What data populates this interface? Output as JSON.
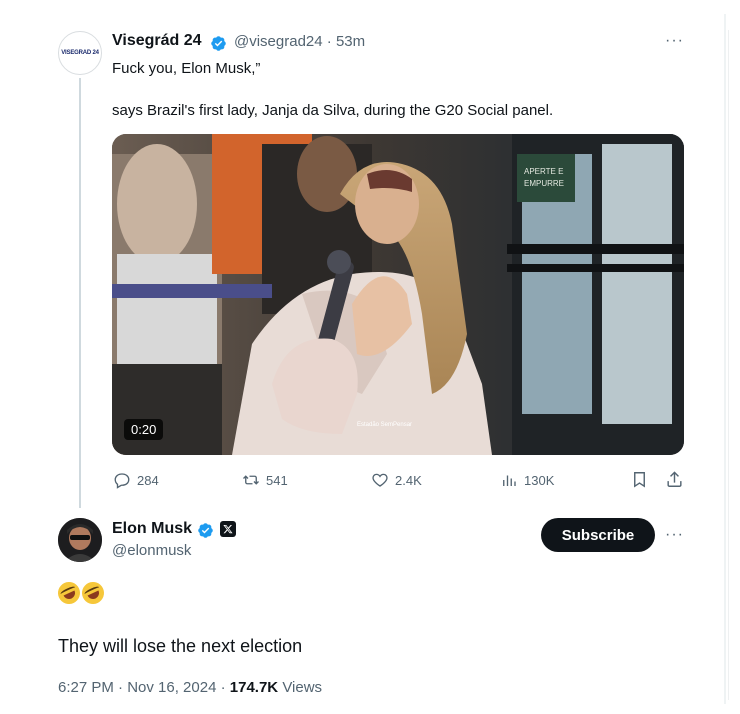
{
  "original_tweet": {
    "author_name": "Visegrád 24",
    "handle": "@visegrad24",
    "separator": "·",
    "time_ago": "53m",
    "avatar_text": "VISEGRAD 24",
    "line1": "Fuck you, Elon Musk,”",
    "line2": "says Brazil's first lady, Janja da Silva, during the G20 Social panel.",
    "video": {
      "duration": "0:20",
      "watermark": "Estadão SemPensar"
    },
    "actions": {
      "replies": "284",
      "reposts": "541",
      "likes": "2.4K",
      "views": "130K"
    }
  },
  "reply_tweet": {
    "author_name": "Elon Musk",
    "handle": "@elonmusk",
    "subscribe_label": "Subscribe",
    "emoji_count": 2,
    "text": "They will lose the next election",
    "time": "6:27 PM · Nov 16, 2024 ·",
    "views_count": "174.7K",
    "views_label": "Views"
  },
  "colors": {
    "verified_blue": "#1d9bf0",
    "text_primary": "#0f1419",
    "text_secondary": "#536471",
    "thread_line": "#cfd9de"
  }
}
